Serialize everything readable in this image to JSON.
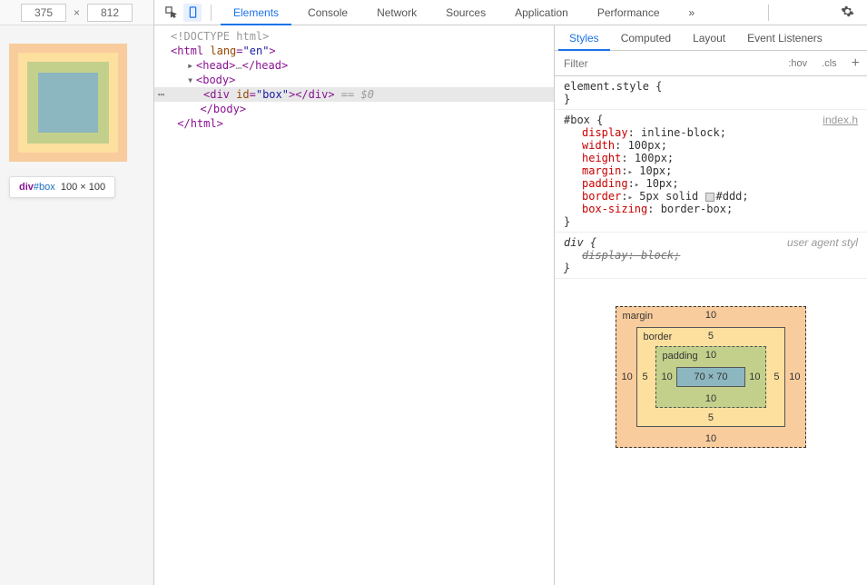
{
  "dims": {
    "w": "375",
    "x": "×",
    "h": "812"
  },
  "preview_tooltip": {
    "tag": "div",
    "id": "#box",
    "size": "100 × 100"
  },
  "main_tabs": [
    "Elements",
    "Console",
    "Network",
    "Sources",
    "Application",
    "Performance"
  ],
  "overflow": "»",
  "dom": {
    "doctype": "<!DOCTYPE html>",
    "html_open": "html",
    "html_lang_attr": "lang",
    "html_lang_val": "\"en\"",
    "head": "head",
    "head_ellipsis": "…",
    "body": "body",
    "div": "div",
    "div_id_attr": "id",
    "div_id_val": "\"box\"",
    "eq": " == ",
    "dollar": "$0",
    "body_close": "body",
    "html_close": "html"
  },
  "side_tabs": [
    "Styles",
    "Computed",
    "Layout",
    "Event Listeners"
  ],
  "filter_placeholder": "Filter",
  "filter_btns": {
    "hov": ":hov",
    "cls": ".cls",
    "plus": "+"
  },
  "rules": {
    "el_style": "element.style {",
    "box_sel": "#box {",
    "box_src": "index.h",
    "p_display": {
      "n": "display",
      "v": "inline-block;"
    },
    "p_width": {
      "n": "width",
      "v": "100px;"
    },
    "p_height": {
      "n": "height",
      "v": "100px;"
    },
    "p_margin": {
      "n": "margin",
      "v": "10px;"
    },
    "p_padding": {
      "n": "padding",
      "v": "10px;"
    },
    "p_border": {
      "n": "border",
      "v": "5px solid ",
      "c": "#ddd;"
    },
    "p_boxsizing": {
      "n": "box-sizing",
      "v": "border-box;"
    },
    "div_sel": "div {",
    "ua": "user agent styl",
    "p_div_display": {
      "n": "display",
      "v": "block;"
    },
    "close": "}"
  },
  "box_model": {
    "margin": "margin",
    "border": "border",
    "padding": "padding",
    "m": "10",
    "b": "5",
    "p": "10",
    "content": "70 × 70"
  }
}
